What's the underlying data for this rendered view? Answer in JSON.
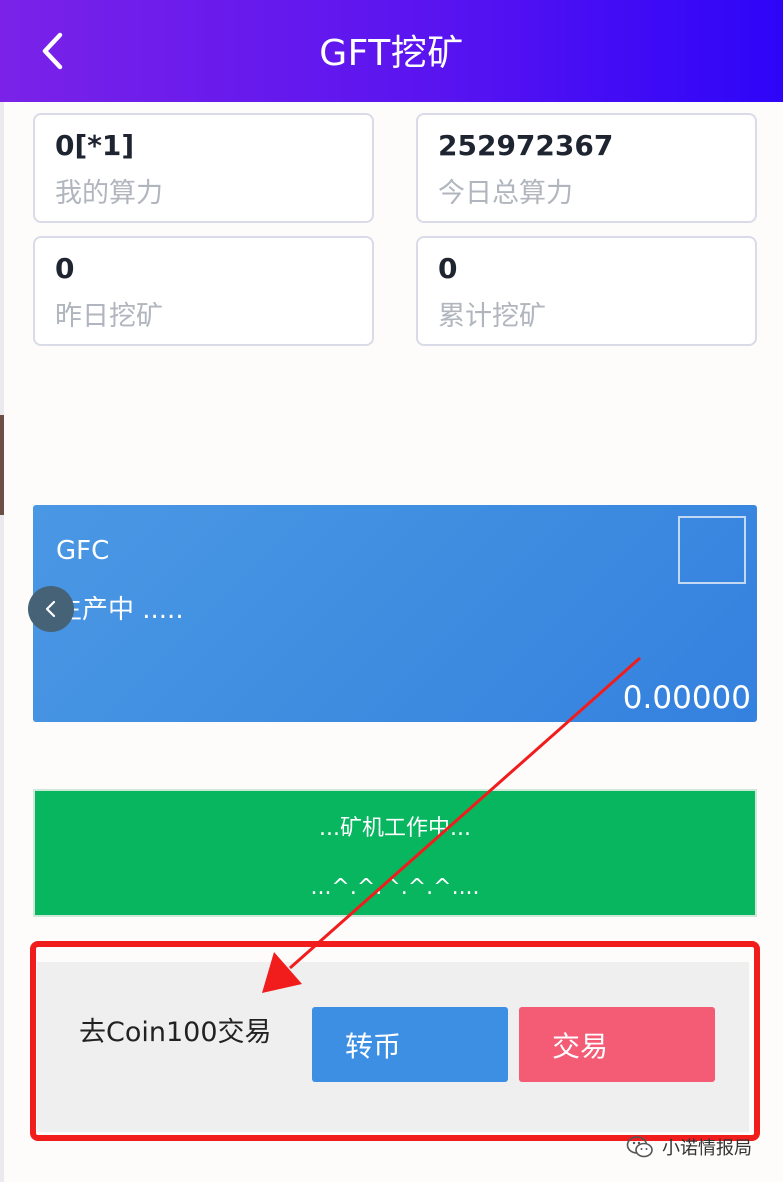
{
  "header": {
    "title": "GFT挖矿"
  },
  "stats": [
    {
      "value": "0[*1]",
      "label": "我的算力"
    },
    {
      "value": "252972367",
      "label": "今日总算力"
    },
    {
      "value": "0",
      "label": "昨日挖矿"
    },
    {
      "value": "0",
      "label": "累计挖矿"
    }
  ],
  "mining_card": {
    "coin": "GFC",
    "status": "生产中 .....",
    "amount": "0.00000"
  },
  "work_panel": {
    "line1": "...矿机工作中...",
    "line2": "...^.^.^.^.^...."
  },
  "trade": {
    "label": "去Coin100交易",
    "transfer_button": "转币",
    "trade_button": "交易"
  },
  "watermark": {
    "text": "小诺情报局"
  },
  "colors": {
    "header_gradient": [
      "#7a22e8",
      "#2d05f8"
    ],
    "card_blue": "#3f8de0",
    "panel_green": "#07b65f",
    "button_blue": "#3d8fe3",
    "button_red": "#f45b75",
    "annotation_red": "#f11c1c"
  },
  "icons": {
    "back": "chevron-left-icon",
    "prev": "chevron-left-icon",
    "watermark": "wechat-icon"
  }
}
